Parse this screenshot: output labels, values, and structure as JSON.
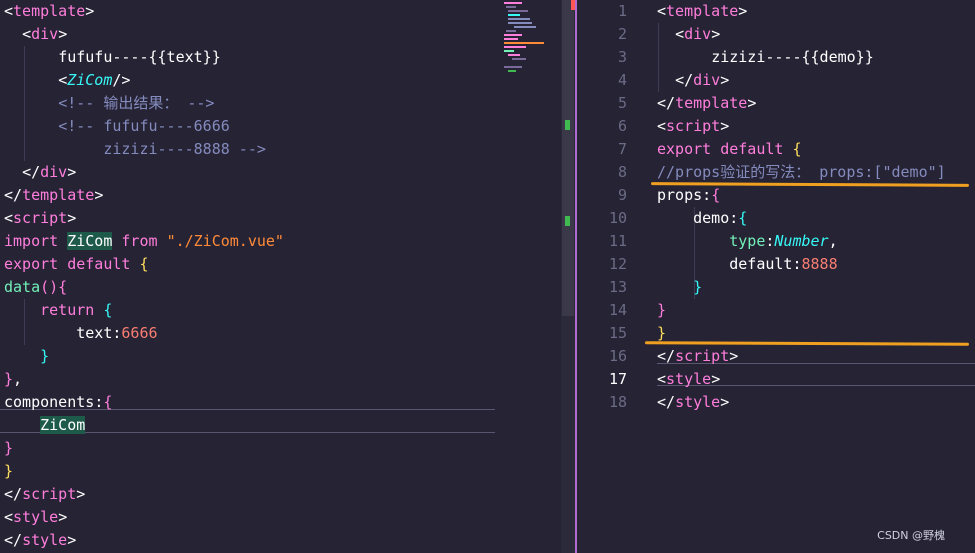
{
  "left_editor": {
    "lines": [
      {
        "indent": "",
        "parts": [
          {
            "t": "<",
            "c": "punc"
          },
          {
            "t": "template",
            "c": "kwp"
          },
          {
            "t": ">",
            "c": "punc"
          }
        ]
      },
      {
        "indent": "  ",
        "parts": [
          {
            "t": "<",
            "c": "punc"
          },
          {
            "t": "div",
            "c": "kwp"
          },
          {
            "t": ">",
            "c": "punc"
          }
        ]
      },
      {
        "indent": "      ",
        "parts": [
          {
            "t": "fufufu----{{text}}",
            "c": "prop"
          }
        ]
      },
      {
        "indent": "      ",
        "parts": [
          {
            "t": "<",
            "c": "punc"
          },
          {
            "t": "ZiCom",
            "c": "comp"
          },
          {
            "t": "/>",
            "c": "punc"
          }
        ]
      },
      {
        "indent": "      ",
        "parts": [
          {
            "t": "<!-- 输出结果： -->",
            "c": "cmt"
          }
        ]
      },
      {
        "indent": "      ",
        "parts": [
          {
            "t": "<!-- fufufu----6666",
            "c": "cmt"
          }
        ]
      },
      {
        "indent": "           ",
        "parts": [
          {
            "t": "zizizi----8888 -->",
            "c": "cmt"
          }
        ]
      },
      {
        "indent": "  ",
        "parts": [
          {
            "t": "</",
            "c": "punc"
          },
          {
            "t": "div",
            "c": "kwp"
          },
          {
            "t": ">",
            "c": "punc"
          }
        ]
      },
      {
        "indent": "",
        "parts": [
          {
            "t": "</",
            "c": "punc"
          },
          {
            "t": "template",
            "c": "kwp"
          },
          {
            "t": ">",
            "c": "punc"
          }
        ]
      },
      {
        "indent": "",
        "parts": [
          {
            "t": "<",
            "c": "punc"
          },
          {
            "t": "script",
            "c": "kwp"
          },
          {
            "t": ">",
            "c": "punc"
          }
        ]
      },
      {
        "indent": "",
        "parts": [
          {
            "t": "import ",
            "c": "kwp"
          },
          {
            "t": "ZiCom",
            "c": "hl"
          },
          {
            "t": " from ",
            "c": "kwp"
          },
          {
            "t": "\"./ZiCom.vue\"",
            "c": "str"
          }
        ]
      },
      {
        "indent": "",
        "parts": [
          {
            "t": "export default ",
            "c": "kwp"
          },
          {
            "t": "{",
            "c": "brace"
          }
        ]
      },
      {
        "indent": "",
        "parts": [
          {
            "t": "data",
            "c": "tag"
          },
          {
            "t": "(){",
            "c": "brace2"
          }
        ]
      },
      {
        "indent": "    ",
        "parts": [
          {
            "t": "return ",
            "c": "kwp"
          },
          {
            "t": "{",
            "c": "brace3"
          }
        ]
      },
      {
        "indent": "        ",
        "parts": [
          {
            "t": "text",
            "c": "prop"
          },
          {
            "t": ":",
            "c": "punc"
          },
          {
            "t": "6666",
            "c": "num-c"
          }
        ]
      },
      {
        "indent": "    ",
        "parts": [
          {
            "t": "}",
            "c": "brace3"
          }
        ]
      },
      {
        "indent": "",
        "parts": [
          {
            "t": "}",
            "c": "brace2"
          },
          {
            "t": ",",
            "c": "punc"
          }
        ]
      },
      {
        "indent": "",
        "parts": [
          {
            "t": "components",
            "c": "prop"
          },
          {
            "t": ":",
            "c": "punc"
          },
          {
            "t": "{",
            "c": "brace2"
          }
        ]
      },
      {
        "indent": "    ",
        "parts": [
          {
            "t": "ZiCom",
            "c": "hl"
          }
        ]
      },
      {
        "indent": "",
        "parts": [
          {
            "t": "}",
            "c": "brace2"
          }
        ]
      },
      {
        "indent": "",
        "parts": [
          {
            "t": "}",
            "c": "brace"
          }
        ]
      },
      {
        "indent": "",
        "parts": [
          {
            "t": "</",
            "c": "punc"
          },
          {
            "t": "script",
            "c": "kwp"
          },
          {
            "t": ">",
            "c": "punc"
          }
        ]
      },
      {
        "indent": "",
        "parts": [
          {
            "t": "<",
            "c": "punc"
          },
          {
            "t": "style",
            "c": "kwp"
          },
          {
            "t": ">",
            "c": "punc"
          }
        ]
      },
      {
        "indent": "",
        "parts": [
          {
            "t": "</",
            "c": "punc"
          },
          {
            "t": "style",
            "c": "kwp"
          },
          {
            "t": ">",
            "c": "punc"
          }
        ]
      }
    ]
  },
  "right_editor": {
    "line_numbers": [
      "1",
      "2",
      "3",
      "4",
      "5",
      "6",
      "7",
      "8",
      "9",
      "10",
      "11",
      "12",
      "13",
      "14",
      "15",
      "16",
      "17",
      "18"
    ],
    "active_line": "17",
    "lines": [
      {
        "indent": "",
        "parts": [
          {
            "t": "<",
            "c": "punc"
          },
          {
            "t": "template",
            "c": "kwp"
          },
          {
            "t": ">",
            "c": "punc"
          }
        ]
      },
      {
        "indent": "  ",
        "parts": [
          {
            "t": "<",
            "c": "punc"
          },
          {
            "t": "div",
            "c": "kwp"
          },
          {
            "t": ">",
            "c": "punc"
          }
        ]
      },
      {
        "indent": "      ",
        "parts": [
          {
            "t": "zizizi----{{demo}}",
            "c": "prop"
          }
        ]
      },
      {
        "indent": "  ",
        "parts": [
          {
            "t": "</",
            "c": "punc"
          },
          {
            "t": "div",
            "c": "kwp"
          },
          {
            "t": ">",
            "c": "punc"
          }
        ]
      },
      {
        "indent": "",
        "parts": [
          {
            "t": "</",
            "c": "punc"
          },
          {
            "t": "template",
            "c": "kwp"
          },
          {
            "t": ">",
            "c": "punc"
          }
        ]
      },
      {
        "indent": "",
        "parts": [
          {
            "t": "<",
            "c": "punc"
          },
          {
            "t": "script",
            "c": "kwp"
          },
          {
            "t": ">",
            "c": "punc"
          }
        ]
      },
      {
        "indent": "",
        "parts": [
          {
            "t": "export default ",
            "c": "kwp"
          },
          {
            "t": "{",
            "c": "brace"
          }
        ]
      },
      {
        "indent": "",
        "parts": [
          {
            "t": "//props验证的写法： props:[\"demo\"]",
            "c": "cmt"
          }
        ]
      },
      {
        "indent": "",
        "parts": [
          {
            "t": "props",
            "c": "prop"
          },
          {
            "t": ":",
            "c": "punc"
          },
          {
            "t": "{",
            "c": "brace2"
          }
        ]
      },
      {
        "indent": "    ",
        "parts": [
          {
            "t": "demo",
            "c": "prop"
          },
          {
            "t": ":",
            "c": "punc"
          },
          {
            "t": "{",
            "c": "brace3"
          }
        ]
      },
      {
        "indent": "        ",
        "parts": [
          {
            "t": "type",
            "c": "tag"
          },
          {
            "t": ":",
            "c": "punc"
          },
          {
            "t": "Number",
            "c": "comp"
          },
          {
            "t": ",",
            "c": "punc"
          }
        ]
      },
      {
        "indent": "        ",
        "parts": [
          {
            "t": "default",
            "c": "prop"
          },
          {
            "t": ":",
            "c": "punc"
          },
          {
            "t": "8888",
            "c": "num-c"
          }
        ]
      },
      {
        "indent": "    ",
        "parts": [
          {
            "t": "}",
            "c": "brace3"
          }
        ]
      },
      {
        "indent": "",
        "parts": [
          {
            "t": "}",
            "c": "brace2"
          }
        ]
      },
      {
        "indent": "",
        "parts": [
          {
            "t": "}",
            "c": "brace"
          }
        ]
      },
      {
        "indent": "",
        "parts": [
          {
            "t": "</",
            "c": "punc"
          },
          {
            "t": "script",
            "c": "kwp"
          },
          {
            "t": ">",
            "c": "punc"
          }
        ]
      },
      {
        "indent": "",
        "parts": [
          {
            "t": "<",
            "c": "punc"
          },
          {
            "t": "style",
            "c": "kwp"
          },
          {
            "t": ">",
            "c": "punc"
          }
        ]
      },
      {
        "indent": "",
        "parts": [
          {
            "t": "</",
            "c": "punc"
          },
          {
            "t": "style",
            "c": "kwp"
          },
          {
            "t": ">",
            "c": "punc"
          }
        ]
      }
    ]
  },
  "watermark": "CSDN @野槐",
  "colors": {
    "background": "#262335",
    "divider": "#b16ad1",
    "underline": "#f0a020",
    "keyword": "#ff7edb",
    "string": "#ff8b39",
    "number": "#f97e72",
    "comment": "#848bbd"
  }
}
